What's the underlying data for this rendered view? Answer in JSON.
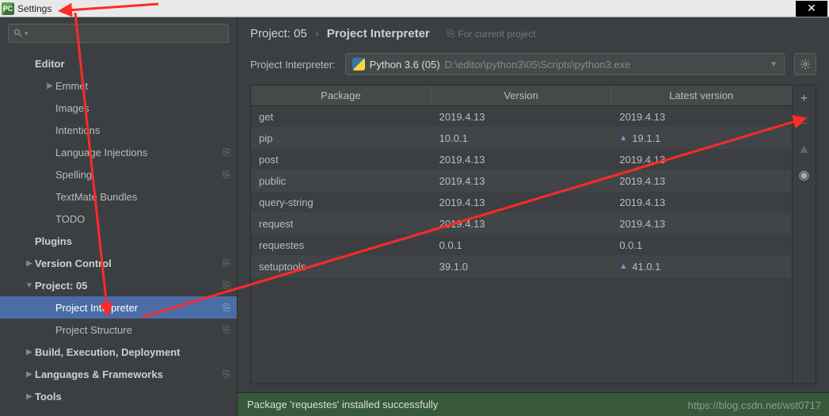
{
  "window": {
    "title": "Settings"
  },
  "sidebar": {
    "search_placeholder": "",
    "items": [
      {
        "label": "Editor",
        "depth": 1,
        "chev": "",
        "bold": true,
        "copy": false
      },
      {
        "label": "Emmet",
        "depth": 2,
        "chev": "▶",
        "bold": false,
        "copy": false
      },
      {
        "label": "Images",
        "depth": 2,
        "chev": "",
        "bold": false,
        "copy": false
      },
      {
        "label": "Intentions",
        "depth": 2,
        "chev": "",
        "bold": false,
        "copy": false
      },
      {
        "label": "Language Injections",
        "depth": 2,
        "chev": "",
        "bold": false,
        "copy": true
      },
      {
        "label": "Spelling",
        "depth": 2,
        "chev": "",
        "bold": false,
        "copy": true
      },
      {
        "label": "TextMate Bundles",
        "depth": 2,
        "chev": "",
        "bold": false,
        "copy": false
      },
      {
        "label": "TODO",
        "depth": 2,
        "chev": "",
        "bold": false,
        "copy": false
      },
      {
        "label": "Plugins",
        "depth": 1,
        "chev": "",
        "bold": true,
        "copy": false
      },
      {
        "label": "Version Control",
        "depth": 1,
        "chev": "▶",
        "bold": true,
        "copy": true
      },
      {
        "label": "Project: 05",
        "depth": 1,
        "chev": "▼",
        "bold": true,
        "copy": true
      },
      {
        "label": "Project Interpreter",
        "depth": 2,
        "chev": "",
        "bold": false,
        "copy": true
      },
      {
        "label": "Project Structure",
        "depth": 2,
        "chev": "",
        "bold": false,
        "copy": true
      },
      {
        "label": "Build, Execution, Deployment",
        "depth": 1,
        "chev": "▶",
        "bold": true,
        "copy": false
      },
      {
        "label": "Languages & Frameworks",
        "depth": 1,
        "chev": "▶",
        "bold": true,
        "copy": true
      },
      {
        "label": "Tools",
        "depth": 1,
        "chev": "▶",
        "bold": true,
        "copy": false
      }
    ],
    "selected_index": 11
  },
  "breadcrumb": {
    "crumb1": "Project: 05",
    "crumb2": "Project Interpreter",
    "hint": "For current project"
  },
  "interpreter": {
    "label": "Project Interpreter:",
    "name": "Python 3.6 (05)",
    "path": "D:\\editor\\python3\\05\\Scripts\\python3.exe"
  },
  "table": {
    "headers": [
      "Package",
      "Version",
      "Latest version"
    ],
    "rows": [
      {
        "pkg": "get",
        "ver": "2019.4.13",
        "latest": "2019.4.13",
        "upgrade": false
      },
      {
        "pkg": "pip",
        "ver": "10.0.1",
        "latest": "19.1.1",
        "upgrade": true
      },
      {
        "pkg": "post",
        "ver": "2019.4.13",
        "latest": "2019.4.13",
        "upgrade": false
      },
      {
        "pkg": "public",
        "ver": "2019.4.13",
        "latest": "2019.4.13",
        "upgrade": false
      },
      {
        "pkg": "query-string",
        "ver": "2019.4.13",
        "latest": "2019.4.13",
        "upgrade": false
      },
      {
        "pkg": "request",
        "ver": "2019.4.13",
        "latest": "2019.4.13",
        "upgrade": false
      },
      {
        "pkg": "requestes",
        "ver": "0.0.1",
        "latest": "0.0.1",
        "upgrade": false
      },
      {
        "pkg": "setuptools",
        "ver": "39.1.0",
        "latest": "41.0.1",
        "upgrade": true
      }
    ]
  },
  "toolbar": {
    "add": "+",
    "remove": "−",
    "up": "▲",
    "eye": "◉"
  },
  "status": {
    "message": "Package 'requestes' installed successfully"
  },
  "watermark": "https://blog.csdn.net/wst0717"
}
